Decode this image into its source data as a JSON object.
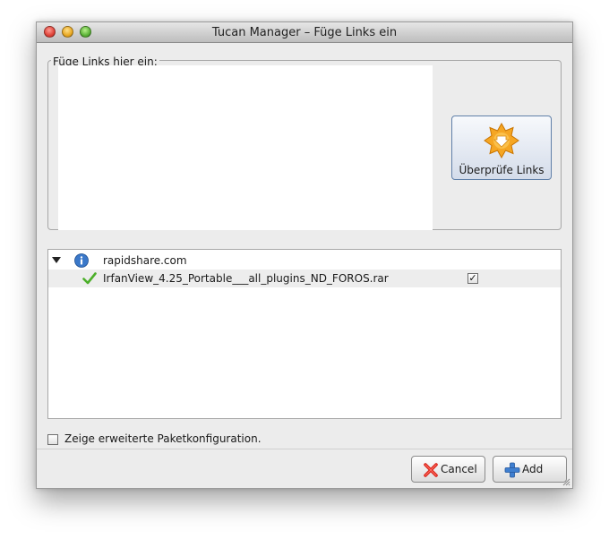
{
  "window": {
    "title": "Tucan Manager – Füge Links ein"
  },
  "links_group": {
    "label": "Füge Links hier ein:",
    "value": ""
  },
  "check_button": {
    "label": "Überprüfe Links",
    "icon": "starburst-down-arrow-icon"
  },
  "tree": {
    "service": {
      "name": "rapidshare.com",
      "icon": "info-icon",
      "expanded": true
    },
    "files": [
      {
        "name": "IrfanView_4.25_Portable___all_plugins_ND_FOROS.rar",
        "status_icon": "green-check-icon",
        "checked": true
      }
    ]
  },
  "advanced_config": {
    "label": "Zeige erweiterte Paketkonfiguration.",
    "checked": false
  },
  "buttons": {
    "cancel": {
      "label": "Cancel",
      "icon": "red-x-icon"
    },
    "add": {
      "label": "Add",
      "icon": "blue-plus-icon"
    }
  },
  "colors": {
    "accent": "#f39c12",
    "info": "#3a78c9",
    "ok": "#4caf2a"
  }
}
